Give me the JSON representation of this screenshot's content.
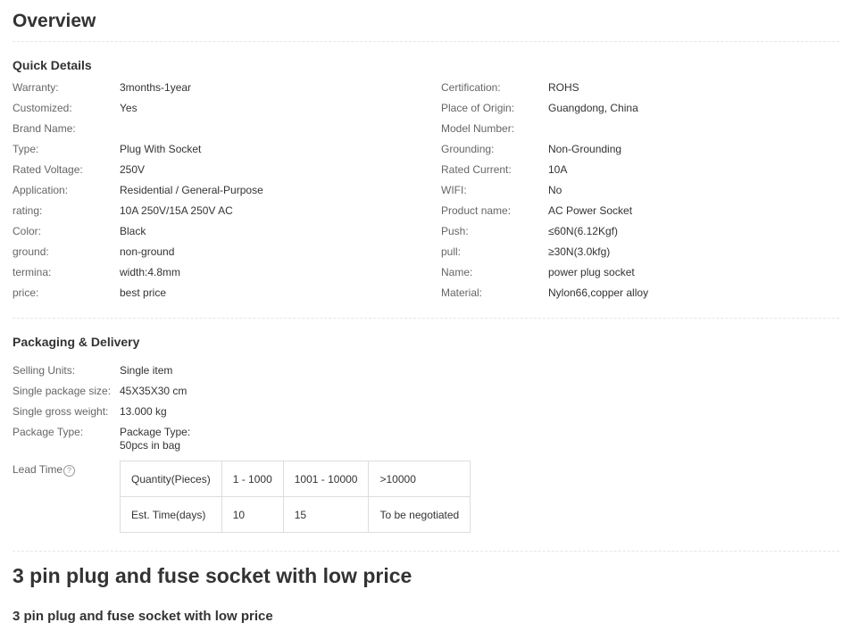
{
  "overview_title": "Overview",
  "quick_details": {
    "title": "Quick Details",
    "left": [
      {
        "label": "Warranty:",
        "value": "3months-1year"
      },
      {
        "label": "Customized:",
        "value": "Yes"
      },
      {
        "label": "Brand Name:",
        "value": ""
      },
      {
        "label": "Type:",
        "value": "Plug With Socket"
      },
      {
        "label": "Rated Voltage:",
        "value": "250V"
      },
      {
        "label": "Application:",
        "value": "Residential / General-Purpose"
      },
      {
        "label": "rating:",
        "value": "10A 250V/15A 250V AC"
      },
      {
        "label": "Color:",
        "value": "Black"
      },
      {
        "label": "ground:",
        "value": "non-ground"
      },
      {
        "label": "termina:",
        "value": "width:4.8mm"
      },
      {
        "label": "price:",
        "value": "best price"
      }
    ],
    "right": [
      {
        "label": "Certification:",
        "value": "ROHS"
      },
      {
        "label": "Place of Origin:",
        "value": "Guangdong, China"
      },
      {
        "label": "Model Number:",
        "value": ""
      },
      {
        "label": "Grounding:",
        "value": "Non-Grounding"
      },
      {
        "label": "Rated Current:",
        "value": "10A"
      },
      {
        "label": "WIFI:",
        "value": "No"
      },
      {
        "label": "Product name:",
        "value": "AC Power Socket"
      },
      {
        "label": "Push:",
        "value": "≤60N(6.12Kgf)"
      },
      {
        "label": "pull:",
        "value": "≥30N(3.0kfg)"
      },
      {
        "label": "Name:",
        "value": "power plug socket"
      },
      {
        "label": "Material:",
        "value": "Nylon66,copper alloy"
      }
    ]
  },
  "packaging": {
    "title": "Packaging & Delivery",
    "rows": [
      {
        "label": "Selling Units:",
        "value": "Single item"
      },
      {
        "label": "Single package size:",
        "value": "45X35X30 cm"
      },
      {
        "label": "Single gross weight:",
        "value": "13.000 kg"
      },
      {
        "label": "Package Type:",
        "value": "Package Type:",
        "value2": "50pcs in bag"
      }
    ],
    "lead_time_label": "Lead Time",
    "lead_time_help": "?",
    "lead_table": [
      [
        "Quantity(Pieces)",
        "1 - 1000",
        "1001 - 10000",
        ">10000"
      ],
      [
        "Est. Time(days)",
        "10",
        "15",
        "To be negotiated"
      ]
    ]
  },
  "product_title": "3 pin plug and fuse socket with low price",
  "product_subtitle": "3 pin plug and fuse socket with low price"
}
